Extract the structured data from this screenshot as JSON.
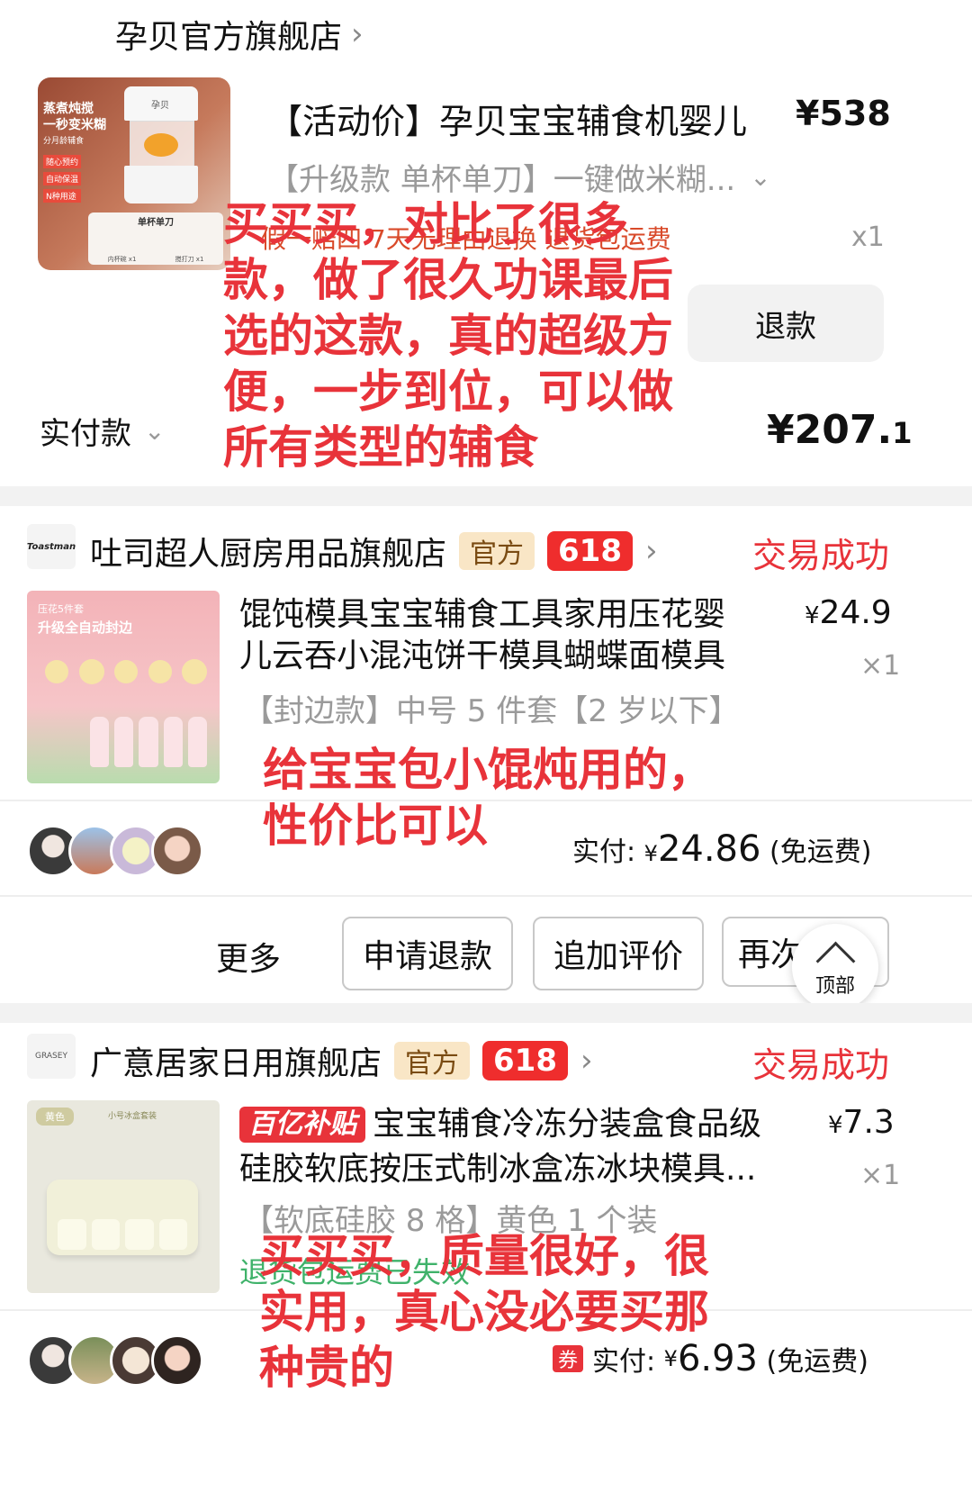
{
  "order1": {
    "store": "孕贝官方旗舰店",
    "thumb_text": [
      "蒸煮炖搅",
      "一秒变米糊",
      "分月龄辅食",
      "随心预约",
      "自动保温",
      "N种用途",
      "单杯单刀",
      "内杯碗 x1",
      "搅打刀 x1"
    ],
    "thumb_brand": "孕贝",
    "title": "【活动价】孕贝宝宝辅食机婴儿",
    "price": "¥538",
    "sku": "【升级款 单杯单刀】一键做米糊...",
    "services": "假一赔四  7天无理由退换  退货包运费",
    "qty": "x1",
    "refund_button": "退款",
    "paid_label": "实付款",
    "paid_amount": "¥207.",
    "paid_decimal": "1",
    "annotation": [
      "买买买，对比了很多",
      "款，做了很久功课最后",
      "选的这款，真的超级方",
      "便，一步到位，可以做",
      "所有类型的辅食"
    ]
  },
  "order2": {
    "store": "吐司超人厨房用品旗舰店",
    "logo_text": "Toastman",
    "badge_official": "官方",
    "badge_618": "618",
    "status": "交易成功",
    "thumb_text": [
      "压花5件套",
      "升级全自动封边"
    ],
    "title_line1": "馄饨模具宝宝辅食工具家用压花婴",
    "title_line2": "儿云吞小混沌饼干模具蝴蝶面模具",
    "price_yen": "¥",
    "price": "24.9",
    "qty": "×1",
    "sku": "【封边款】中号 5 件套【2 岁以下】",
    "annotation": [
      "给宝宝包小馄炖用的，",
      "性价比可以"
    ],
    "paid_label": "实付:",
    "paid_yen": "¥",
    "paid_amount": "24.86",
    "paid_note": "(免运费)",
    "actions": [
      "更多",
      "申请退款",
      "追加评价",
      "再次"
    ],
    "top_button": "顶部"
  },
  "order3": {
    "store": "广意居家日用旗舰店",
    "logo_text": "GRASEY",
    "badge_official": "官方",
    "badge_618": "618",
    "status": "交易成功",
    "subsidy": "百亿补贴",
    "thumb_text": [
      "黄色",
      "小号冰盒套装"
    ],
    "title_line1": "宝宝辅食冷冻分装盒食品级",
    "title_line2": "硅胶软底按压式制冰盒冻冰块模具...",
    "price_yen": "¥",
    "price": "7.3",
    "qty": "×1",
    "sku": "【软底硅胶 8 格】黄色 1 个装",
    "service_text": "退货包运费已失效",
    "annotation": [
      "买买买，质量很好，很",
      "实用，真心没必要买那",
      "种贵的"
    ],
    "coupon": "券",
    "paid_label": "实付:",
    "paid_yen": "¥",
    "paid_amount": "6.93",
    "paid_note": "(免运费)"
  },
  "colors": {
    "accent_red": "#e8333a",
    "badge_gold_bg": "#f9e6c6",
    "divider_gray": "#f2f2f2"
  }
}
